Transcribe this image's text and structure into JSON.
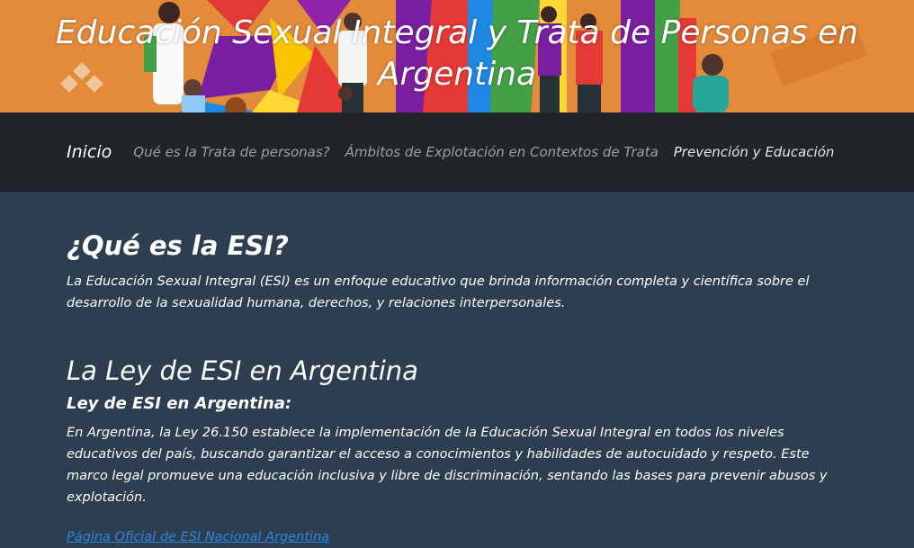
{
  "banner": {
    "title": "Educación Sexual Integral y Trata de Personas en Argentina"
  },
  "nav": {
    "brand": "Inicio",
    "links": [
      "Qué es la Trata de personas?",
      "Ámbitos de Explotación en Contextos de Trata",
      "Prevención y Educación"
    ]
  },
  "section1": {
    "heading": "¿Qué es la ESI?",
    "text": "La Educación Sexual Integral (ESI) es un enfoque educativo que brinda información completa y científica sobre el desarrollo de la sexualidad humana, derechos, y relaciones interpersonales."
  },
  "section2": {
    "heading": "La Ley de ESI en Argentina",
    "subheading": "Ley de ESI en Argentina:",
    "text": "En Argentina, la Ley 26.150 establece la implementación de la Educación Sexual Integral en todos los niveles educativos del país, buscando garantizar el acceso a conocimientos y habilidades de autocuidado y respeto. Este marco legal promueve una educación inclusiva y libre de discriminación, sentando las bases para prevenir abusos y explotación.",
    "link": "Página Oficial de ESI Nacional Argentina"
  }
}
